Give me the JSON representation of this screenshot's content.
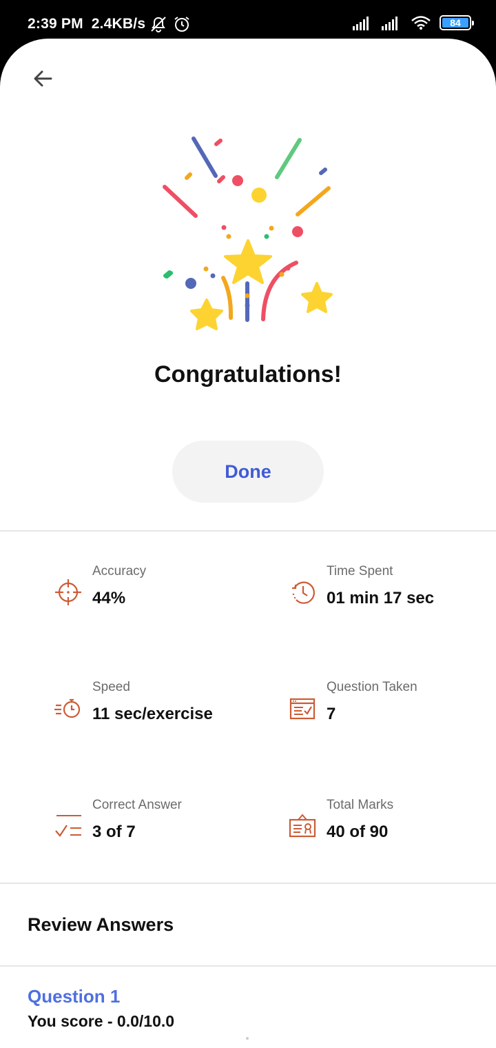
{
  "status_bar": {
    "time": "2:39 PM",
    "net_speed": "2.4KB/s",
    "battery": "84",
    "icons": [
      "mute-bell-icon",
      "alarm-icon",
      "signal-icon",
      "signal-icon",
      "wifi-icon",
      "battery-icon"
    ]
  },
  "header": {
    "back_icon": "arrow-left-icon"
  },
  "hero": {
    "illustration": "confetti-stars-illustration",
    "title": "Congratulations!"
  },
  "done_button": {
    "label": "Done"
  },
  "stats": [
    {
      "icon": "crosshair-icon",
      "label": "Accuracy",
      "value": "44%"
    },
    {
      "icon": "clock-history-icon",
      "label": "Time Spent",
      "value": "01 min 17 sec"
    },
    {
      "icon": "stopwatch-speed-icon",
      "label": "Speed",
      "value": "11 sec/exercise"
    },
    {
      "icon": "checklist-window-icon",
      "label": "Question Taken",
      "value": "7"
    },
    {
      "icon": "check-lines-icon",
      "label": "Correct Answer",
      "value": "3 of 7"
    },
    {
      "icon": "certificate-icon",
      "label": "Total Marks",
      "value": "40 of 90"
    }
  ],
  "review": {
    "title": "Review Answers",
    "questions": [
      {
        "title": "Question 1",
        "score": "You score - 0.0/10.0"
      }
    ]
  },
  "colors": {
    "accent_blue": "#3f5bd6",
    "icon_orange": "#cc5b35",
    "star_yellow": "#fdd331"
  }
}
